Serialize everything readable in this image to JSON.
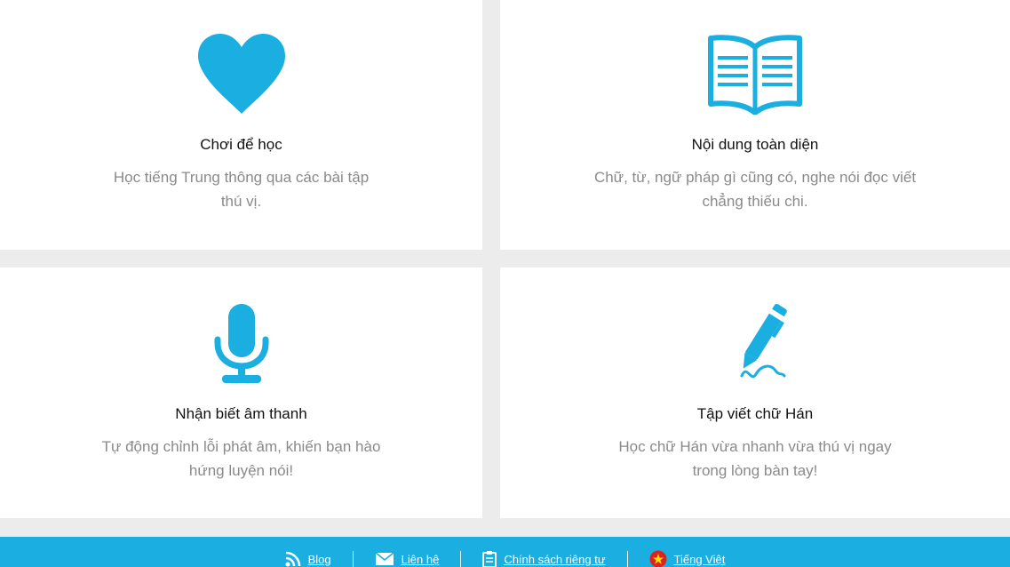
{
  "colors": {
    "accent": "#1baee0",
    "background": "#ececec",
    "card": "#ffffff",
    "title": "#111111",
    "description": "#8a8a8a"
  },
  "features": [
    {
      "icon": "heart-icon",
      "title": "Chơi để học",
      "description": "Học tiếng Trung thông qua các bài tập thú vị."
    },
    {
      "icon": "open-book-icon",
      "title": "Nội dung toàn diện",
      "description": "Chữ, từ, ngữ pháp gì cũng có, nghe nói đọc viết chẳng thiếu chi."
    },
    {
      "icon": "microphone-icon",
      "title": "Nhận biết âm thanh",
      "description": "Tự động chỉnh lỗi phát âm, khiến bạn hào hứng luyện nói!"
    },
    {
      "icon": "pen-icon",
      "title": "Tập viết chữ Hán",
      "description": "Học chữ Hán vừa nhanh vừa thú vị ngay trong lòng bàn tay!"
    }
  ],
  "footer": {
    "links": [
      {
        "icon": "rss-icon",
        "label": "Blog"
      },
      {
        "icon": "mail-icon",
        "label": "Liên hệ"
      },
      {
        "icon": "clipboard-icon",
        "label": "Chính sách riêng tư"
      },
      {
        "icon": "vietnam-flag-icon",
        "label": "Tiếng Việt"
      }
    ]
  }
}
